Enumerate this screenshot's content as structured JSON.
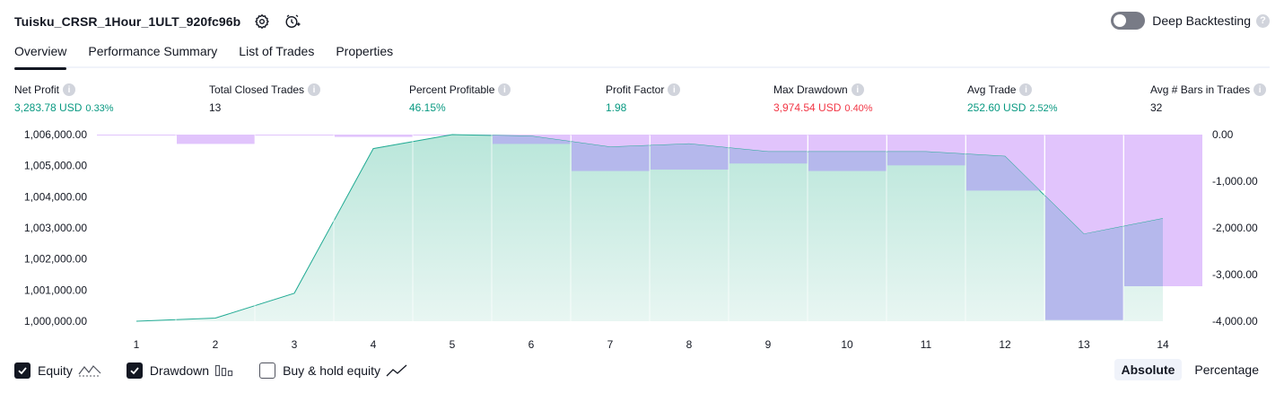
{
  "header": {
    "strategy_name": "Tuisku_CRSR_1Hour_1ULT_920fc96b",
    "icons": [
      "settings-icon",
      "add-alert-icon"
    ],
    "deep_backtesting_label": "Deep Backtesting",
    "deep_backtesting_enabled": false
  },
  "tabs": [
    {
      "label": "Overview",
      "active": true
    },
    {
      "label": "Performance Summary",
      "active": false
    },
    {
      "label": "List of Trades",
      "active": false
    },
    {
      "label": "Properties",
      "active": false
    }
  ],
  "stats": [
    {
      "label": "Net Profit",
      "value": "3,283.78 USD",
      "pct": "0.33%",
      "color": "green"
    },
    {
      "label": "Total Closed Trades",
      "value": "13",
      "pct": "",
      "color": "dark"
    },
    {
      "label": "Percent Profitable",
      "value": "46.15%",
      "pct": "",
      "color": "green"
    },
    {
      "label": "Profit Factor",
      "value": "1.98",
      "pct": "",
      "color": "green"
    },
    {
      "label": "Max Drawdown",
      "value": "3,974.54 USD",
      "pct": "0.40%",
      "color": "red"
    },
    {
      "label": "Avg Trade",
      "value": "252.60 USD",
      "pct": "2.52%",
      "color": "green"
    },
    {
      "label": "Avg # Bars in Trades",
      "value": "32",
      "pct": "",
      "color": "dark"
    }
  ],
  "chart_data": {
    "type": "area",
    "x": [
      1,
      2,
      3,
      4,
      5,
      6,
      7,
      8,
      9,
      10,
      11,
      12,
      13,
      14
    ],
    "x_tick_labels": [
      "1",
      "2",
      "3",
      "4",
      "5",
      "6",
      "7",
      "8",
      "9",
      "10",
      "11",
      "12",
      "13",
      "14"
    ],
    "series": [
      {
        "name": "Equity",
        "axis": "left",
        "values": [
          1000000,
          1000100,
          1000900,
          1005550,
          1006000,
          1005950,
          1005600,
          1005700,
          1005450,
          1005450,
          1005450,
          1005300,
          1002800,
          1003300
        ]
      },
      {
        "name": "Drawdown",
        "axis": "right",
        "type": "bar",
        "values": [
          0,
          -200,
          0,
          -50,
          0,
          -200,
          -780,
          -750,
          -620,
          -780,
          -660,
          -1200,
          -3975,
          -3250
        ]
      }
    ],
    "left_axis": {
      "ylim": [
        1000000,
        1006000
      ],
      "ticks": [
        "1,006,000.00",
        "1,005,000.00",
        "1,004,000.00",
        "1,003,000.00",
        "1,002,000.00",
        "1,001,000.00",
        "1,000,000.00"
      ]
    },
    "right_axis": {
      "ylim": [
        -4000,
        0
      ],
      "ticks": [
        "0.00",
        "-1,000.00",
        "-2,000.00",
        "-3,000.00",
        "-4,000.00"
      ]
    },
    "colors": {
      "equity_line": "#22ab94",
      "equity_fill": "#cdeee5",
      "drawdown_fill": "#e1c4fc",
      "overlap": "#b5b8ec"
    }
  },
  "legend": [
    {
      "label": "Equity",
      "checked": true,
      "icon": "equity-icon"
    },
    {
      "label": "Drawdown",
      "checked": true,
      "icon": "drawdown-bars-icon"
    },
    {
      "label": "Buy & hold equity",
      "checked": false,
      "icon": "buy-hold-line-icon"
    }
  ],
  "modes": [
    {
      "label": "Absolute",
      "active": true
    },
    {
      "label": "Percentage",
      "active": false
    }
  ]
}
